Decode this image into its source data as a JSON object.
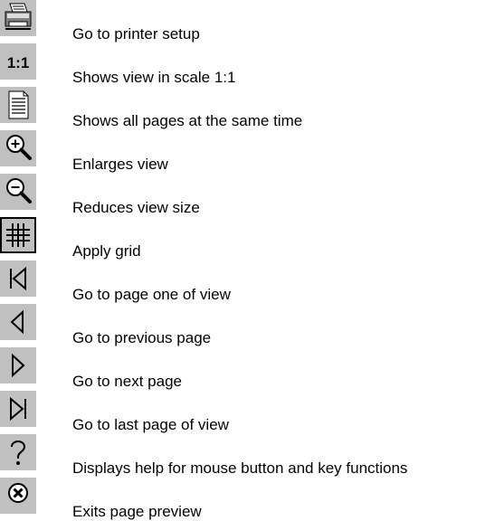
{
  "items": [
    {
      "icon": "printer-icon",
      "label": "Go to printer setup"
    },
    {
      "icon": "scale-1-1-icon",
      "label": "Shows view in scale 1:1",
      "icon_text": "1:1"
    },
    {
      "icon": "all-pages-icon",
      "label": "Shows all pages at the same time"
    },
    {
      "icon": "zoom-in-icon",
      "label": "Enlarges view"
    },
    {
      "icon": "zoom-out-icon",
      "label": "Reduces view size"
    },
    {
      "icon": "grid-icon",
      "label": "Apply grid"
    },
    {
      "icon": "first-page-icon",
      "label": "Go to page one of view"
    },
    {
      "icon": "previous-page-icon",
      "label": "Go to previous page"
    },
    {
      "icon": "next-page-icon",
      "label": "Go to next page"
    },
    {
      "icon": "last-page-icon",
      "label": "Go to last page of view"
    },
    {
      "icon": "help-icon",
      "label": "Displays help for mouse button and key functions"
    },
    {
      "icon": "exit-icon",
      "label": "Exits page preview"
    }
  ],
  "colors": {
    "button_face": "#c0c0c0",
    "text": "#000000"
  }
}
